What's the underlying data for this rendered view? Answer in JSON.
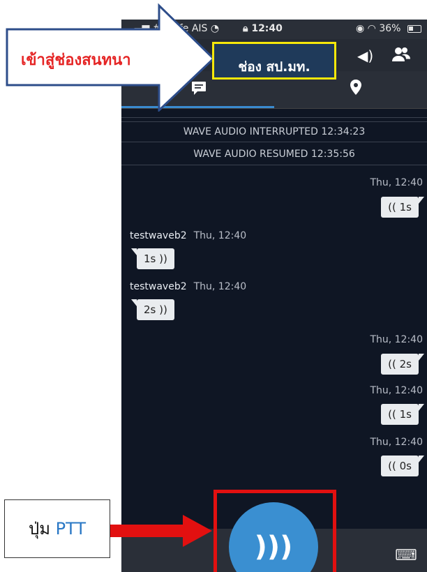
{
  "status": {
    "carrier": " #SI...fe AIS",
    "time": "12:40",
    "battery": "36%"
  },
  "header": {
    "channel_name": "ช่อง สป.มท.",
    "speaker_icon": "speaker-icon",
    "users_icon": "users-icon"
  },
  "tabs": [
    {
      "icon": "chat-icon"
    },
    {
      "icon": "location-pin-icon"
    }
  ],
  "system_messages": [
    "",
    "WAVE AUDIO INTERRUPTED 12:34:23",
    "WAVE AUDIO RESUMED 12:35:56"
  ],
  "messages": [
    {
      "direction": "out",
      "timestamp": "Thu, 12:40",
      "duration": "(( 1s"
    },
    {
      "direction": "in",
      "sender": "testwaveb2",
      "timestamp": "Thu, 12:40",
      "duration": "1s ))"
    },
    {
      "direction": "in",
      "sender": "testwaveb2",
      "timestamp": "Thu, 12:40",
      "duration": "2s ))"
    },
    {
      "direction": "out",
      "timestamp": "Thu, 12:40",
      "duration": "(( 2s"
    },
    {
      "direction": "out",
      "timestamp": "Thu, 12:40",
      "duration": "(( 1s"
    },
    {
      "direction": "out",
      "timestamp": "Thu, 12:40",
      "duration": "(( 0s"
    }
  ],
  "ptt": {
    "glyph": ")))"
  },
  "annotations": {
    "callout_text": "เข้าสู่ช่องสนทนา",
    "ptt_label_prefix": "ปุ่ม",
    "ptt_label_word": "PTT"
  },
  "colors": {
    "accent": "#3a8fd1",
    "callout_text": "#e52424",
    "highlight_frame": "#e21010",
    "channel_border": "#f6e80a"
  }
}
